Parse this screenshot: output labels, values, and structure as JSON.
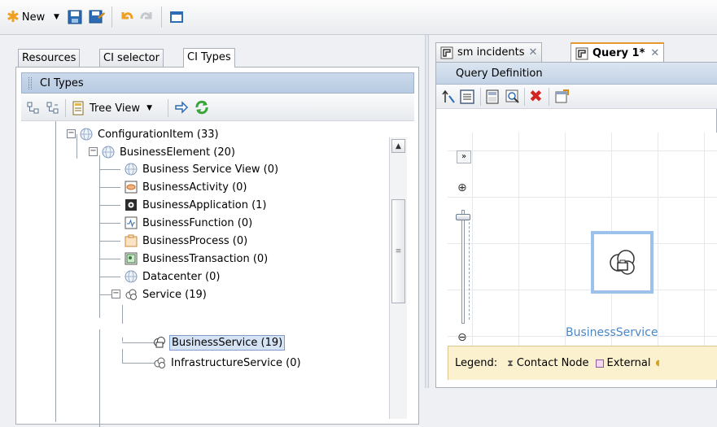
{
  "toolbar": {
    "new_label": "New",
    "icons": [
      "new-star-icon",
      "dropdown-arrow-icon",
      "save-icon",
      "save-all-icon",
      "undo-icon",
      "redo-icon",
      "window-icon"
    ]
  },
  "left": {
    "tabs": [
      "Resources",
      "CI selector",
      "CI Types"
    ],
    "active_tab": "CI Types",
    "panel_title": "CI Types",
    "view_mode": "Tree View",
    "tree": [
      {
        "label": "ConfigurationItem (33)",
        "icon": "ci-globe-icon",
        "level": 0,
        "expanded": true
      },
      {
        "label": "BusinessElement (20)",
        "icon": "ci-globe-icon",
        "level": 1,
        "expanded": true
      },
      {
        "label": "Business Service View (0)",
        "icon": "ci-globe-icon",
        "level": 2
      },
      {
        "label": "BusinessActivity (0)",
        "icon": "business-activity-icon",
        "level": 2
      },
      {
        "label": "BusinessApplication (1)",
        "icon": "business-application-icon",
        "level": 2
      },
      {
        "label": "BusinessFunction (0)",
        "icon": "business-function-icon",
        "level": 2
      },
      {
        "label": "BusinessProcess (0)",
        "icon": "business-process-icon",
        "level": 2
      },
      {
        "label": "BusinessTransaction (0)",
        "icon": "business-transaction-icon",
        "level": 2
      },
      {
        "label": "Datacenter (0)",
        "icon": "ci-globe-icon",
        "level": 2
      },
      {
        "label": "Service (19)",
        "icon": "service-cloud-icon",
        "level": 2,
        "expanded": true
      },
      {
        "label": "BusinessService (19)",
        "icon": "business-service-icon",
        "level": 3,
        "selected": true
      },
      {
        "label": "InfrastructureService (0)",
        "icon": "service-cloud-icon",
        "level": 3
      }
    ]
  },
  "right": {
    "tabs": [
      {
        "label": "sm incidents",
        "active": false
      },
      {
        "label": "Query 1*",
        "active": true
      }
    ],
    "panel_title": "Query Definition",
    "node_label": "BusinessService",
    "legend": {
      "label": "Legend:",
      "items": [
        "Contact Node",
        "External"
      ]
    }
  },
  "colors": {
    "accent": "#4a87c7",
    "selected_bg": "#d5e3f5",
    "legend_bg": "#fbf1cf",
    "active_tab_border": "#e59a2c"
  }
}
